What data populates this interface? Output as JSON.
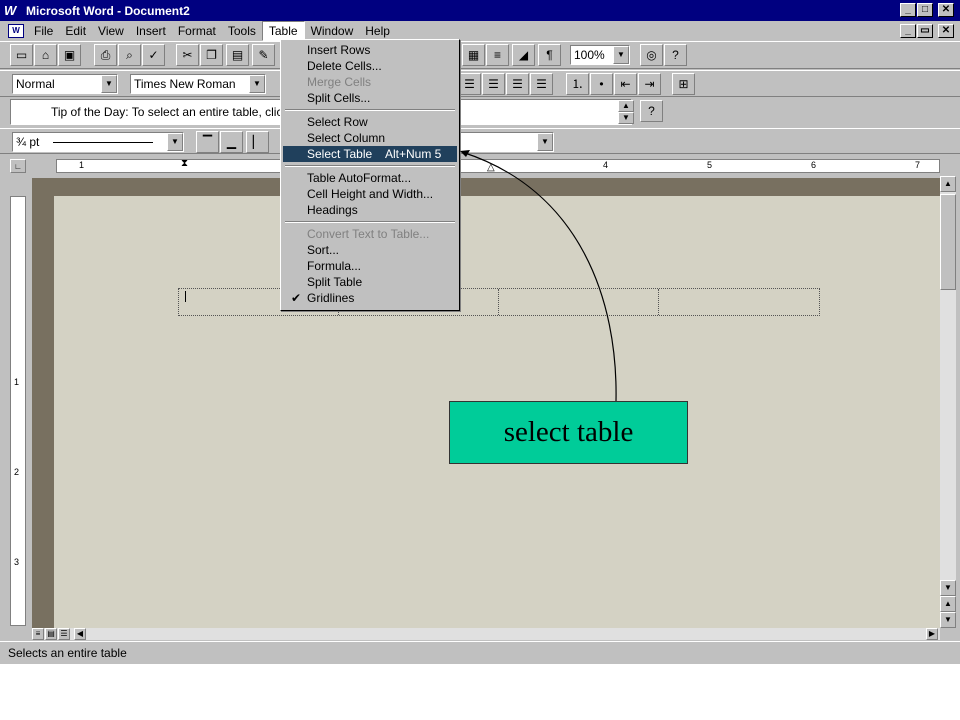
{
  "window": {
    "title": "Microsoft Word - Document2",
    "controls": [
      "_",
      "□",
      "✕"
    ],
    "doc_controls": [
      "_",
      "▭",
      "✕"
    ]
  },
  "menubar": {
    "items": [
      "File",
      "Edit",
      "View",
      "Insert",
      "Format",
      "Tools",
      "Table",
      "Window",
      "Help"
    ]
  },
  "formatting": {
    "style": "Normal",
    "font": "Times New Roman",
    "zoom": "100%"
  },
  "tip": {
    "text": "Tip of the Day: To select an entire table, click"
  },
  "borders": {
    "line_weight": "¾ pt"
  },
  "ruler": {
    "marks": [
      "1",
      "4",
      "5",
      "6",
      "7"
    ],
    "vmarks": [
      "1",
      "2",
      "3"
    ]
  },
  "table_menu": {
    "items": [
      {
        "label": "Insert Rows",
        "disabled": false
      },
      {
        "label": "Delete Cells...",
        "disabled": false
      },
      {
        "label": "Merge Cells",
        "disabled": true
      },
      {
        "label": "Split Cells...",
        "disabled": false
      },
      {
        "label": "Select Row",
        "disabled": false
      },
      {
        "label": "Select Column",
        "disabled": false
      },
      {
        "label": "Select Table",
        "shortcut": "Alt+Num 5",
        "disabled": false,
        "selected": true
      },
      {
        "label": "Table AutoFormat...",
        "disabled": false
      },
      {
        "label": "Cell Height and Width...",
        "disabled": false
      },
      {
        "label": "Headings",
        "disabled": false
      },
      {
        "label": "Convert Text to Table...",
        "disabled": true
      },
      {
        "label": "Sort...",
        "disabled": false
      },
      {
        "label": "Formula...",
        "disabled": false
      },
      {
        "label": "Split Table",
        "disabled": false
      },
      {
        "label": "Gridlines",
        "disabled": false,
        "checked": true
      }
    ]
  },
  "status": {
    "text": "Selects an entire table"
  },
  "callout": {
    "text": "select table",
    "color": "#00cc99"
  },
  "icons": {
    "new": "new-document-icon",
    "open": "open-folder-icon",
    "save": "save-icon",
    "print": "print-icon",
    "preview": "print-preview-icon",
    "spell": "spelling-icon",
    "cut": "cut-icon",
    "copy": "copy-icon",
    "paste": "paste-icon",
    "format_painter": "format-painter-icon",
    "tip": "lightbulb-icon",
    "help": "help-icon",
    "pilcrow": "show-formatting-icon"
  }
}
